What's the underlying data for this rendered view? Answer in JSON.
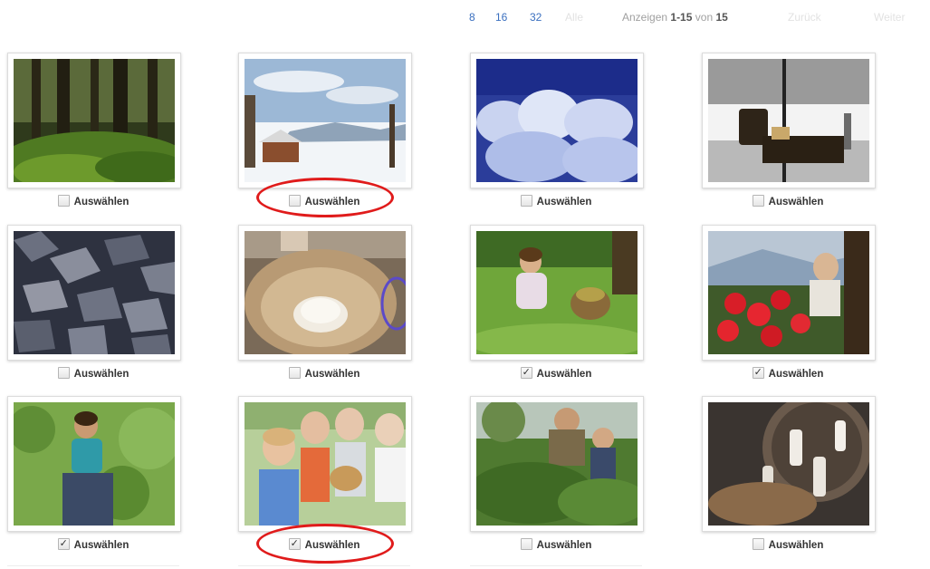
{
  "toolbar": {
    "per_page": [
      "8",
      "16",
      "32"
    ],
    "faint_1": "Alle",
    "status_prefix": "Anzeigen",
    "status_range": "1-15",
    "status_mid": "von",
    "status_total": "15",
    "faint_2": "Zurück",
    "faint_3": "Weiter"
  },
  "colors": {
    "link": "#3a6fbf",
    "highlight": "#e01b1b"
  },
  "gallery": {
    "select_label": "Auswählen",
    "items": [
      {
        "photo": "forest",
        "checked": false
      },
      {
        "photo": "winter-chalet",
        "checked": false
      },
      {
        "photo": "frosted-trees",
        "checked": false
      },
      {
        "photo": "winter-room-chair",
        "checked": false
      },
      {
        "photo": "firewood",
        "checked": false
      },
      {
        "photo": "dough-bowl",
        "checked": false
      },
      {
        "photo": "child-meadow",
        "checked": true
      },
      {
        "photo": "geraniums-balcony",
        "checked": true
      },
      {
        "photo": "child-on-shoulders",
        "checked": true
      },
      {
        "photo": "children-with-kitten",
        "checked": true
      },
      {
        "photo": "gardening",
        "checked": false
      },
      {
        "photo": "wool-spinning",
        "checked": false
      }
    ]
  }
}
